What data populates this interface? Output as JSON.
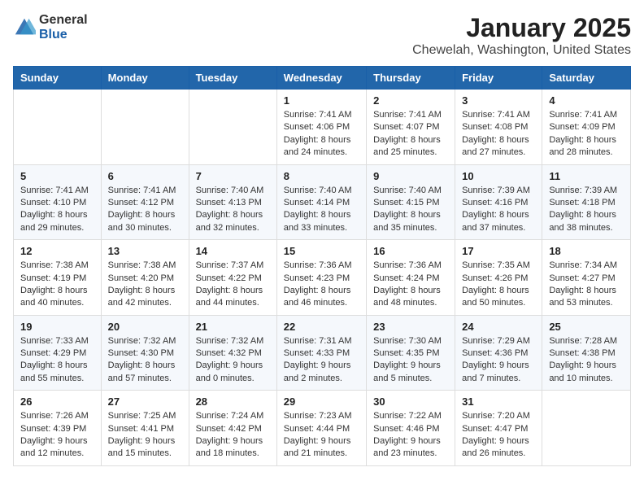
{
  "header": {
    "logo_general": "General",
    "logo_blue": "Blue",
    "month": "January 2025",
    "location": "Chewelah, Washington, United States"
  },
  "weekdays": [
    "Sunday",
    "Monday",
    "Tuesday",
    "Wednesday",
    "Thursday",
    "Friday",
    "Saturday"
  ],
  "weeks": [
    [
      {
        "day": "",
        "info": ""
      },
      {
        "day": "",
        "info": ""
      },
      {
        "day": "",
        "info": ""
      },
      {
        "day": "1",
        "info": "Sunrise: 7:41 AM\nSunset: 4:06 PM\nDaylight: 8 hours\nand 24 minutes."
      },
      {
        "day": "2",
        "info": "Sunrise: 7:41 AM\nSunset: 4:07 PM\nDaylight: 8 hours\nand 25 minutes."
      },
      {
        "day": "3",
        "info": "Sunrise: 7:41 AM\nSunset: 4:08 PM\nDaylight: 8 hours\nand 27 minutes."
      },
      {
        "day": "4",
        "info": "Sunrise: 7:41 AM\nSunset: 4:09 PM\nDaylight: 8 hours\nand 28 minutes."
      }
    ],
    [
      {
        "day": "5",
        "info": "Sunrise: 7:41 AM\nSunset: 4:10 PM\nDaylight: 8 hours\nand 29 minutes."
      },
      {
        "day": "6",
        "info": "Sunrise: 7:41 AM\nSunset: 4:12 PM\nDaylight: 8 hours\nand 30 minutes."
      },
      {
        "day": "7",
        "info": "Sunrise: 7:40 AM\nSunset: 4:13 PM\nDaylight: 8 hours\nand 32 minutes."
      },
      {
        "day": "8",
        "info": "Sunrise: 7:40 AM\nSunset: 4:14 PM\nDaylight: 8 hours\nand 33 minutes."
      },
      {
        "day": "9",
        "info": "Sunrise: 7:40 AM\nSunset: 4:15 PM\nDaylight: 8 hours\nand 35 minutes."
      },
      {
        "day": "10",
        "info": "Sunrise: 7:39 AM\nSunset: 4:16 PM\nDaylight: 8 hours\nand 37 minutes."
      },
      {
        "day": "11",
        "info": "Sunrise: 7:39 AM\nSunset: 4:18 PM\nDaylight: 8 hours\nand 38 minutes."
      }
    ],
    [
      {
        "day": "12",
        "info": "Sunrise: 7:38 AM\nSunset: 4:19 PM\nDaylight: 8 hours\nand 40 minutes."
      },
      {
        "day": "13",
        "info": "Sunrise: 7:38 AM\nSunset: 4:20 PM\nDaylight: 8 hours\nand 42 minutes."
      },
      {
        "day": "14",
        "info": "Sunrise: 7:37 AM\nSunset: 4:22 PM\nDaylight: 8 hours\nand 44 minutes."
      },
      {
        "day": "15",
        "info": "Sunrise: 7:36 AM\nSunset: 4:23 PM\nDaylight: 8 hours\nand 46 minutes."
      },
      {
        "day": "16",
        "info": "Sunrise: 7:36 AM\nSunset: 4:24 PM\nDaylight: 8 hours\nand 48 minutes."
      },
      {
        "day": "17",
        "info": "Sunrise: 7:35 AM\nSunset: 4:26 PM\nDaylight: 8 hours\nand 50 minutes."
      },
      {
        "day": "18",
        "info": "Sunrise: 7:34 AM\nSunset: 4:27 PM\nDaylight: 8 hours\nand 53 minutes."
      }
    ],
    [
      {
        "day": "19",
        "info": "Sunrise: 7:33 AM\nSunset: 4:29 PM\nDaylight: 8 hours\nand 55 minutes."
      },
      {
        "day": "20",
        "info": "Sunrise: 7:32 AM\nSunset: 4:30 PM\nDaylight: 8 hours\nand 57 minutes."
      },
      {
        "day": "21",
        "info": "Sunrise: 7:32 AM\nSunset: 4:32 PM\nDaylight: 9 hours\nand 0 minutes."
      },
      {
        "day": "22",
        "info": "Sunrise: 7:31 AM\nSunset: 4:33 PM\nDaylight: 9 hours\nand 2 minutes."
      },
      {
        "day": "23",
        "info": "Sunrise: 7:30 AM\nSunset: 4:35 PM\nDaylight: 9 hours\nand 5 minutes."
      },
      {
        "day": "24",
        "info": "Sunrise: 7:29 AM\nSunset: 4:36 PM\nDaylight: 9 hours\nand 7 minutes."
      },
      {
        "day": "25",
        "info": "Sunrise: 7:28 AM\nSunset: 4:38 PM\nDaylight: 9 hours\nand 10 minutes."
      }
    ],
    [
      {
        "day": "26",
        "info": "Sunrise: 7:26 AM\nSunset: 4:39 PM\nDaylight: 9 hours\nand 12 minutes."
      },
      {
        "day": "27",
        "info": "Sunrise: 7:25 AM\nSunset: 4:41 PM\nDaylight: 9 hours\nand 15 minutes."
      },
      {
        "day": "28",
        "info": "Sunrise: 7:24 AM\nSunset: 4:42 PM\nDaylight: 9 hours\nand 18 minutes."
      },
      {
        "day": "29",
        "info": "Sunrise: 7:23 AM\nSunset: 4:44 PM\nDaylight: 9 hours\nand 21 minutes."
      },
      {
        "day": "30",
        "info": "Sunrise: 7:22 AM\nSunset: 4:46 PM\nDaylight: 9 hours\nand 23 minutes."
      },
      {
        "day": "31",
        "info": "Sunrise: 7:20 AM\nSunset: 4:47 PM\nDaylight: 9 hours\nand 26 minutes."
      },
      {
        "day": "",
        "info": ""
      }
    ]
  ]
}
